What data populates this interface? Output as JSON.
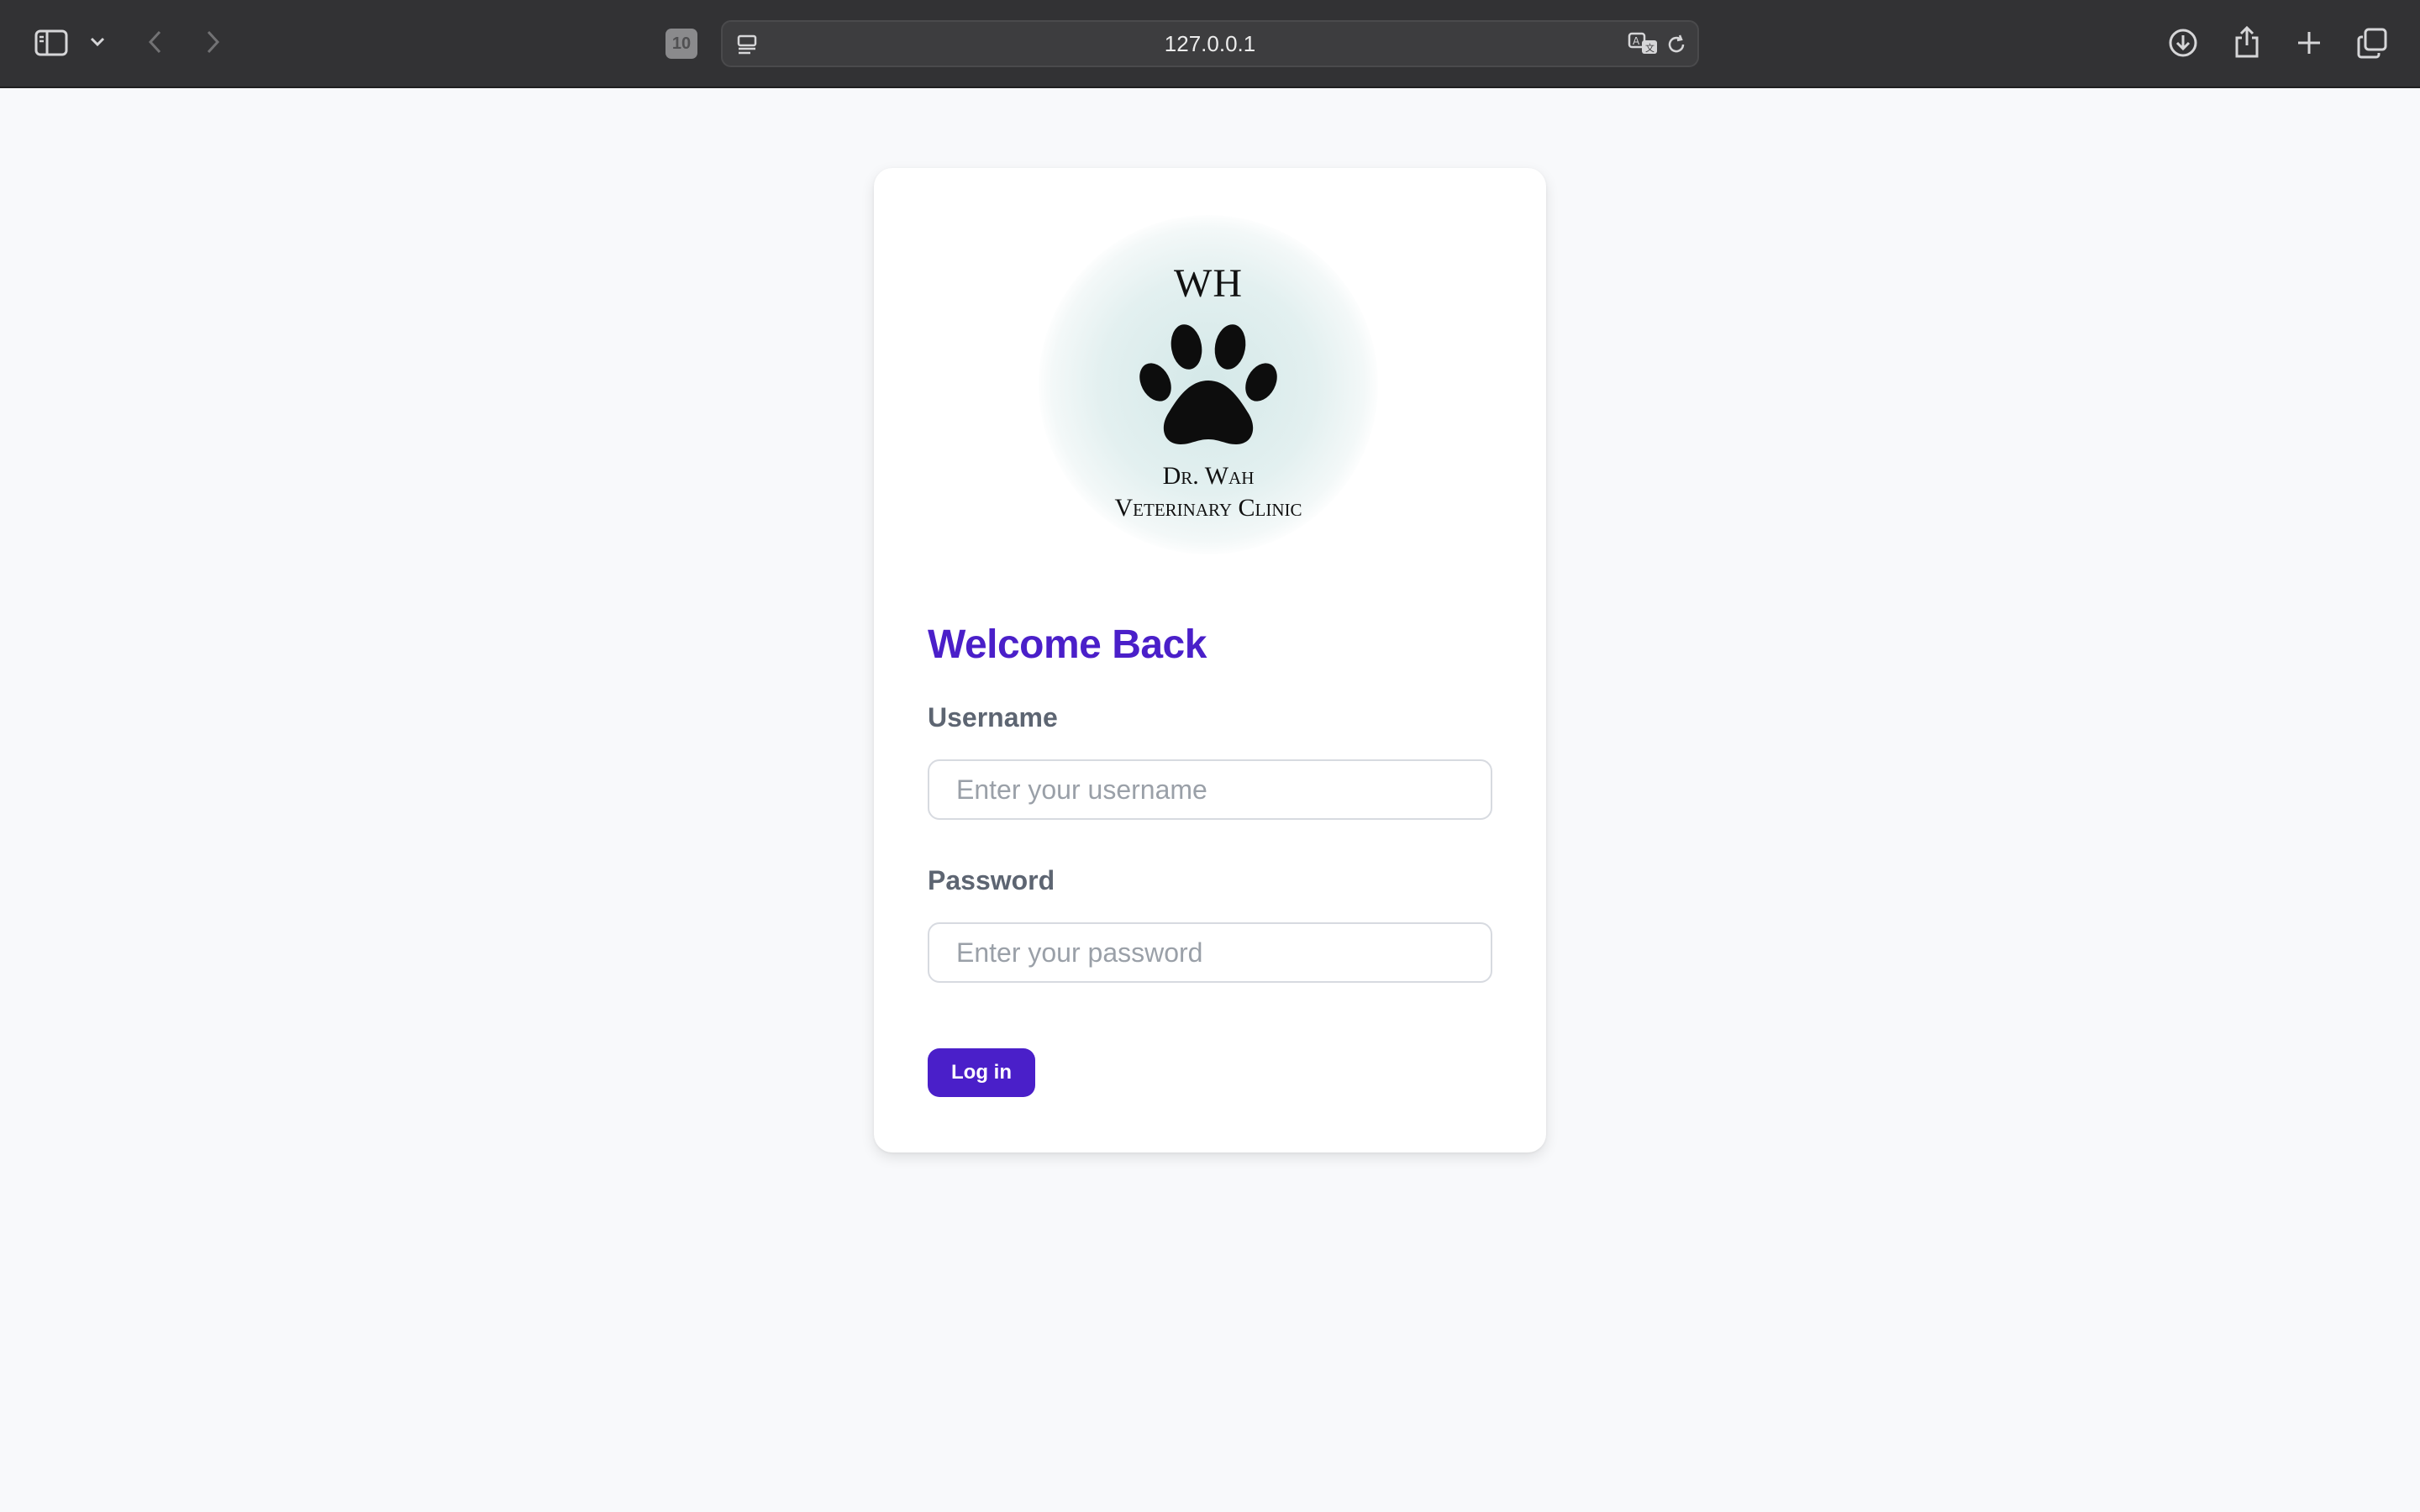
{
  "browser": {
    "tab_count": "10",
    "url": "127.0.0.1",
    "icons": [
      "sidebar-icon",
      "chevron-down-icon",
      "back-icon",
      "forward-icon",
      "reader-icon",
      "translate-icon",
      "reload-icon",
      "download-icon",
      "share-icon",
      "new-tab-icon",
      "tabs-overview-icon"
    ]
  },
  "logo": {
    "monogram": "WH",
    "name": "Dr. Wah",
    "subtitle": "Veterinary Clinic",
    "icon": "paw-icon"
  },
  "login": {
    "title": "Welcome Back",
    "username_label": "Username",
    "username_placeholder": "Enter your username",
    "password_label": "Password",
    "password_placeholder": "Enter your password",
    "submit_label": "Log in"
  },
  "colors": {
    "accent": "#4a1fc9",
    "toolbar": "#323234",
    "background": "#f8f9fb"
  }
}
